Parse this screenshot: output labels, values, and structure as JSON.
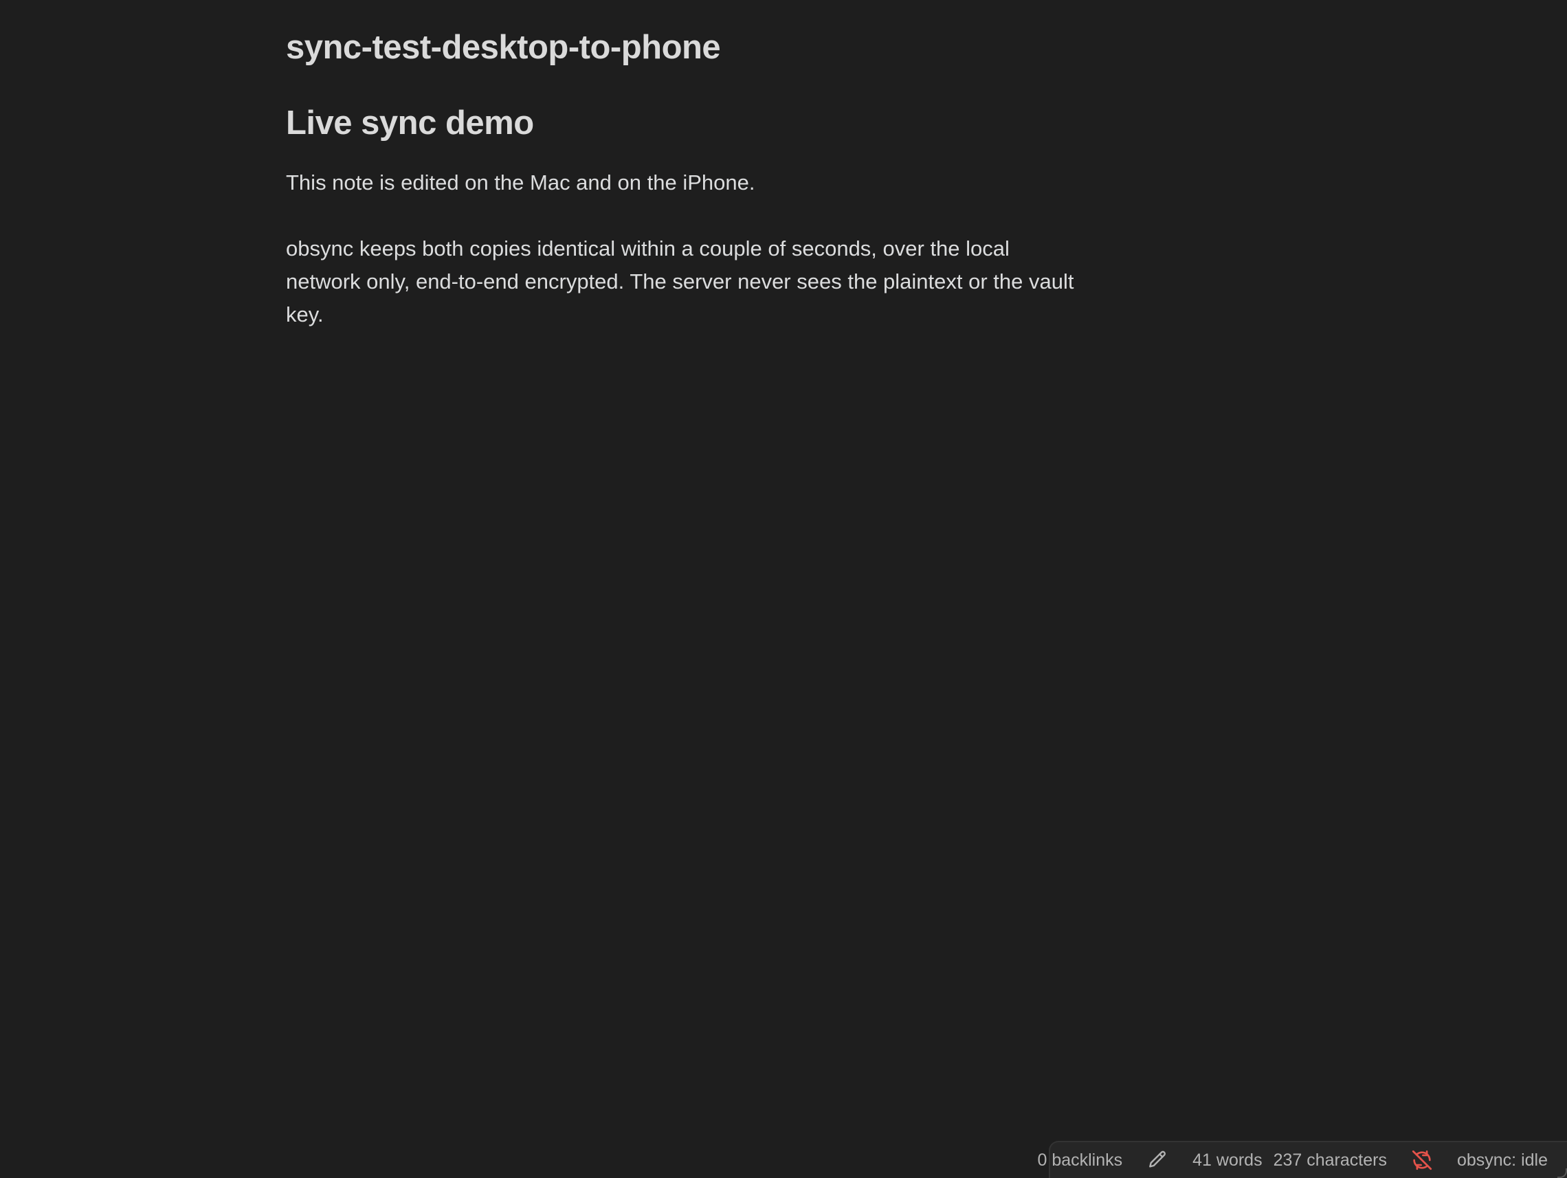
{
  "note": {
    "title": "sync-test-desktop-to-phone",
    "heading": "Live sync demo",
    "paragraphs": [
      "This note is edited on the Mac and on the iPhone.",
      "obsync keeps both copies identical within a couple of seconds, over the local network only, end-to-end encrypted. The server never sees the plaintext or the vault key."
    ]
  },
  "status_bar": {
    "backlinks": "0 backlinks",
    "edit_icon": "pencil-icon",
    "words": "41 words",
    "characters": "237 characters",
    "sync_icon": "sync-off-icon",
    "sync_icon_color": "#e5534b",
    "sync_status": "obsync: idle"
  },
  "colors": {
    "background": "#1e1e1e",
    "text": "#dadada",
    "status_text": "#b3b3b3",
    "status_background": "#262626"
  }
}
